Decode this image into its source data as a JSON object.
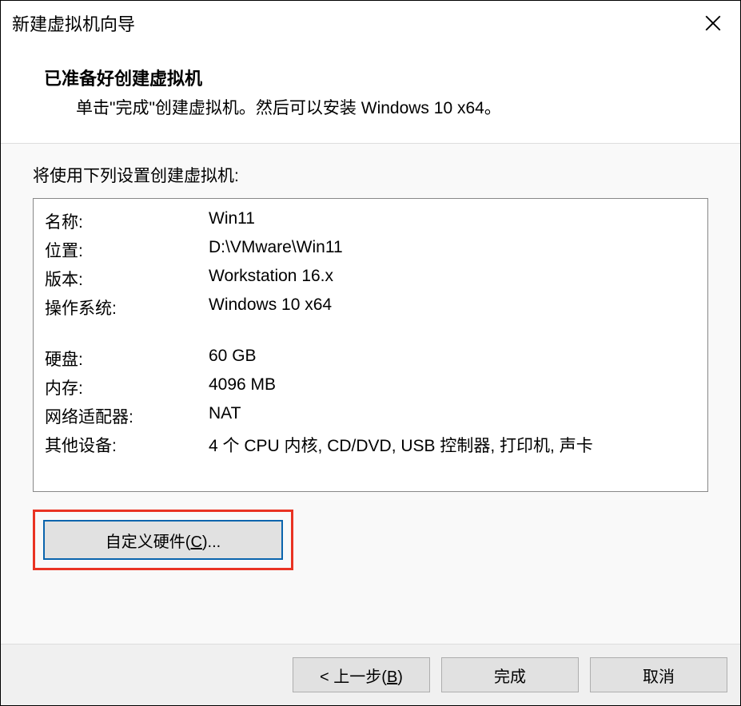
{
  "window": {
    "title": "新建虚拟机向导"
  },
  "header": {
    "heading": "已准备好创建虚拟机",
    "subtext": "单击\"完成\"创建虚拟机。然后可以安装 Windows 10 x64。"
  },
  "content": {
    "label": "将使用下列设置创建虚拟机:",
    "settings": {
      "name_key": "名称:",
      "name_value": "Win11",
      "location_key": "位置:",
      "location_value": "D:\\VMware\\Win11",
      "version_key": "版本:",
      "version_value": "Workstation 16.x",
      "os_key": "操作系统:",
      "os_value": "Windows 10 x64",
      "disk_key": "硬盘:",
      "disk_value": "60 GB",
      "memory_key": "内存:",
      "memory_value": "4096 MB",
      "network_key": "网络适配器:",
      "network_value": "NAT",
      "other_key": "其他设备:",
      "other_value": "4 个 CPU 内核, CD/DVD, USB 控制器, 打印机, 声卡"
    },
    "customize_button": {
      "prefix": "自定义硬件(",
      "mnemonic": "C",
      "suffix": ")..."
    }
  },
  "footer": {
    "back": {
      "prefix": "< 上一步(",
      "mnemonic": "B",
      "suffix": ")"
    },
    "finish": "完成",
    "cancel": "取消"
  }
}
